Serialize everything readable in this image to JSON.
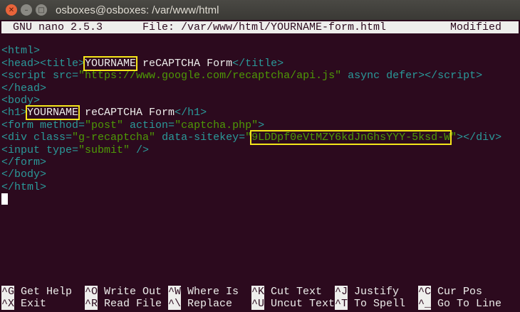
{
  "window": {
    "title": "osboxes@osboxes: /var/www/html"
  },
  "nano": {
    "version": "GNU nano 2.5.3",
    "file": "File: /var/www/html/YOURNAME-form.html",
    "status": "Modified"
  },
  "code": [
    [],
    [
      {
        "t": "tag",
        "v": "<html>"
      }
    ],
    [
      {
        "t": "tag",
        "v": "<head><title>"
      },
      {
        "t": "txt",
        "v": "YOURNAME",
        "hl": true
      },
      {
        "t": "txt",
        "v": " reCAPTCHA Form"
      },
      {
        "t": "tag",
        "v": "</title>"
      }
    ],
    [
      {
        "t": "tag",
        "v": "<script src="
      },
      {
        "t": "str",
        "v": "\"https://www.google.com/recaptcha/api.js\""
      },
      {
        "t": "tag",
        "v": " async defer></script>"
      }
    ],
    [
      {
        "t": "tag",
        "v": "</head>"
      }
    ],
    [
      {
        "t": "tag",
        "v": "<body>"
      }
    ],
    [
      {
        "t": "tag",
        "v": "<h1>"
      },
      {
        "t": "txt",
        "v": "YOURNAME",
        "hl": true
      },
      {
        "t": "txt",
        "v": " reCAPTCHA Form"
      },
      {
        "t": "tag",
        "v": "</h1>"
      }
    ],
    [
      {
        "t": "tag",
        "v": "<form method="
      },
      {
        "t": "str",
        "v": "\"post\""
      },
      {
        "t": "tag",
        "v": " action="
      },
      {
        "t": "str",
        "v": "\"captcha.php\""
      },
      {
        "t": "tag",
        "v": ">"
      }
    ],
    [
      {
        "t": "tag",
        "v": "<div class="
      },
      {
        "t": "str",
        "v": "\"g-recaptcha\""
      },
      {
        "t": "tag",
        "v": " data-sitekey="
      },
      {
        "t": "str",
        "v": "\""
      },
      {
        "t": "str",
        "v": "9LDDpf0eVtMZY6kdJnGhsYYY-5ksd-W",
        "hl": true
      },
      {
        "t": "str",
        "v": "\""
      },
      {
        "t": "tag",
        "v": "></div>"
      }
    ],
    [
      {
        "t": "tag",
        "v": "<input type="
      },
      {
        "t": "str",
        "v": "\"submit\""
      },
      {
        "t": "tag",
        "v": " />"
      }
    ],
    [
      {
        "t": "tag",
        "v": "</form>"
      }
    ],
    [
      {
        "t": "tag",
        "v": "</body>"
      }
    ],
    [
      {
        "t": "tag",
        "v": "</html>"
      }
    ]
  ],
  "shortcuts": [
    {
      "key": "^G",
      "label": "Get Help"
    },
    {
      "key": "^O",
      "label": "Write Out"
    },
    {
      "key": "^W",
      "label": "Where Is"
    },
    {
      "key": "^K",
      "label": "Cut Text"
    },
    {
      "key": "^J",
      "label": "Justify"
    },
    {
      "key": "^C",
      "label": "Cur Pos"
    },
    {
      "key": "^X",
      "label": "Exit"
    },
    {
      "key": "^R",
      "label": "Read File"
    },
    {
      "key": "^\\",
      "label": "Replace"
    },
    {
      "key": "^U",
      "label": "Uncut Text"
    },
    {
      "key": "^T",
      "label": "To Spell"
    },
    {
      "key": "^_",
      "label": "Go To Line"
    }
  ],
  "colors": {
    "background": "#2c0a1e",
    "tag": "#2a9a9a",
    "string": "#4e9a06",
    "highlight": "#f5e61a"
  }
}
